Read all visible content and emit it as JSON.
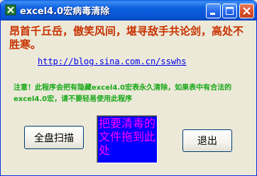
{
  "window": {
    "title": "excel4.0宏病毒清除",
    "controls": {
      "minimize_icon": "minimize-icon",
      "maximize_icon": "maximize-icon",
      "close_icon": "close-icon"
    }
  },
  "main": {
    "motto": "昂首千丘岳，傲笑风间，堪寻敌手共论剑，高处不胜寒。",
    "url": "http://blog.sina.com.cn/sswhs",
    "warning": "注意！此程序会把有隐藏excel4.0宏表永久清除，如果表中有合法的excel4.0宏，请不要轻易使用此程序",
    "drop_zone": "把要清毒的文件拖到此处"
  },
  "buttons": {
    "scan_label": "全盘扫描",
    "exit_label": "退出"
  },
  "colors": {
    "title_bar": "#0a5ddb",
    "motto": "#c83200",
    "warning": "#18a818",
    "link": "#0000ee",
    "drop_bg": "#0000ff",
    "drop_text": "#ff00ff"
  }
}
